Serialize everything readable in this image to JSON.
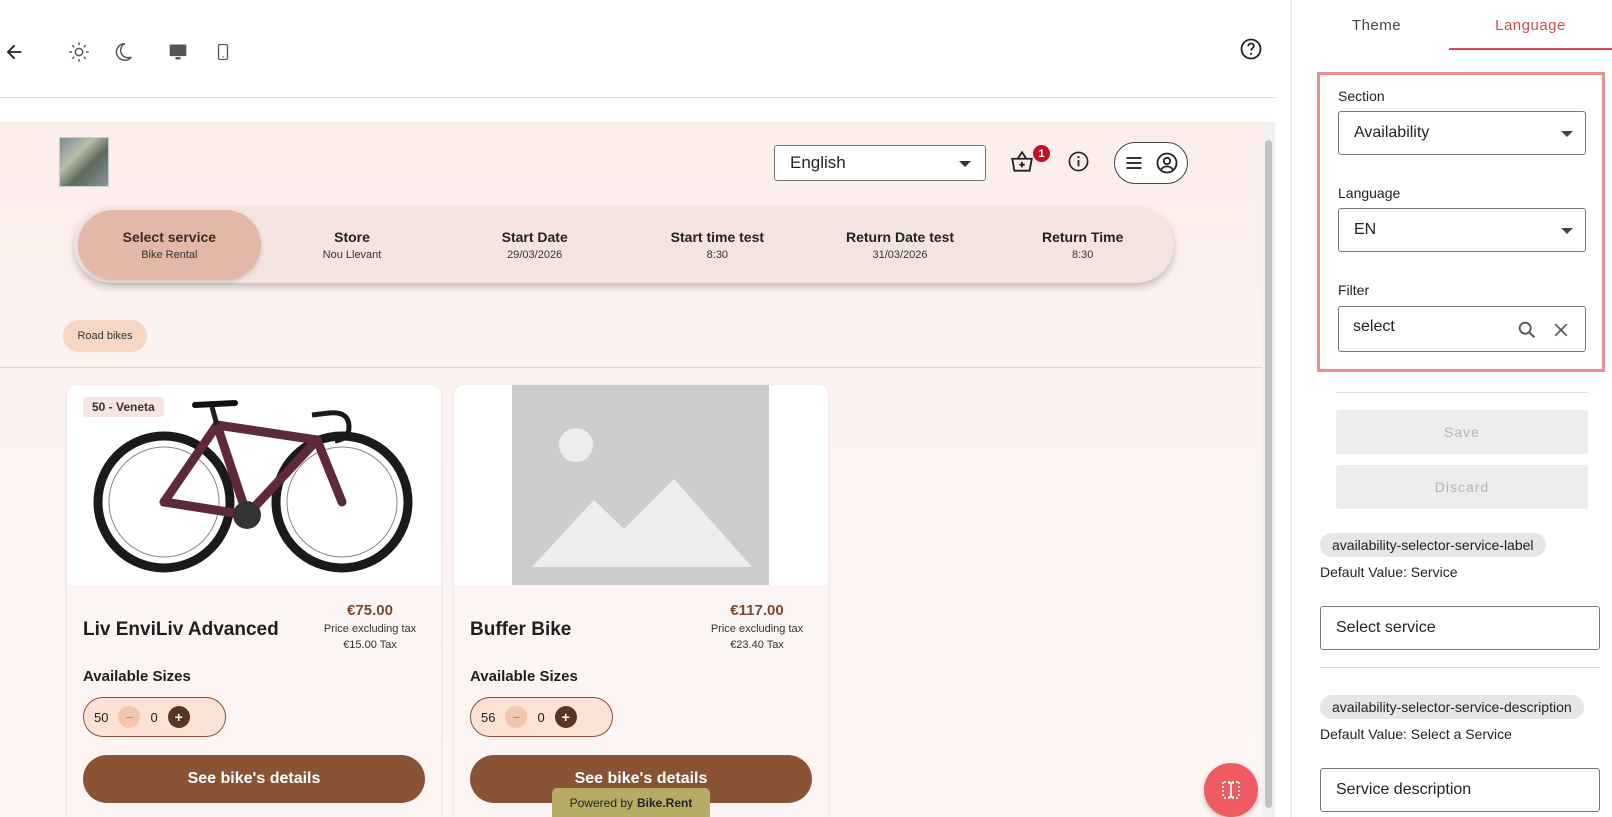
{
  "toolbar": {
    "icons": [
      "back-arrow-icon",
      "sun-icon",
      "moon-icon",
      "desktop-icon",
      "mobile-icon",
      "help-icon"
    ]
  },
  "preview": {
    "language_select": "English",
    "cart_count": "1",
    "steps": [
      {
        "title": "Select service",
        "value": "Bike Rental"
      },
      {
        "title": "Store",
        "value": "Nou Llevant"
      },
      {
        "title": "Start Date",
        "value": "29/03/2026"
      },
      {
        "title": "Start time test",
        "value": "8:30"
      },
      {
        "title": "Return Date test",
        "value": "31/03/2026"
      },
      {
        "title": "Return Time",
        "value": "8:30"
      }
    ],
    "category_chip": "Road bikes",
    "cards": [
      {
        "size_badge": "50 - Veneta",
        "name": "Liv EnviLiv Advanced",
        "price": "€75.00",
        "price_note": "Price excluding tax",
        "tax": "€15.00 Tax",
        "sizes_label": "Available Sizes",
        "size": "50",
        "qty": "0",
        "button": "See bike's details"
      },
      {
        "name": "Buffer Bike",
        "price": "€117.00",
        "price_note": "Price excluding tax",
        "tax": "€23.40 Tax",
        "sizes_label": "Available Sizes",
        "size": "56",
        "qty": "0",
        "button": "See bike's details"
      }
    ],
    "powered_by": "Powered by",
    "powered_brand": "Bike.Rent"
  },
  "panel": {
    "tabs": [
      "Theme",
      "Language"
    ],
    "active_tab": "Language",
    "section_label": "Section",
    "section_value": "Availability",
    "language_label": "Language",
    "language_value": "EN",
    "filter_label": "Filter",
    "filter_value": "select",
    "save": "Save",
    "discard": "Discard",
    "entries": [
      {
        "key": "availability-selector-service-label",
        "default": "Default Value: Service",
        "value": "Select service"
      },
      {
        "key": "availability-selector-service-description",
        "default": "Default Value: Select a Service",
        "value": "Service description"
      }
    ]
  },
  "colors": {
    "accent": "#d9484f",
    "brown": "#8a5336",
    "highlight_border": "#ec8f93",
    "badge": "#c1121f"
  }
}
